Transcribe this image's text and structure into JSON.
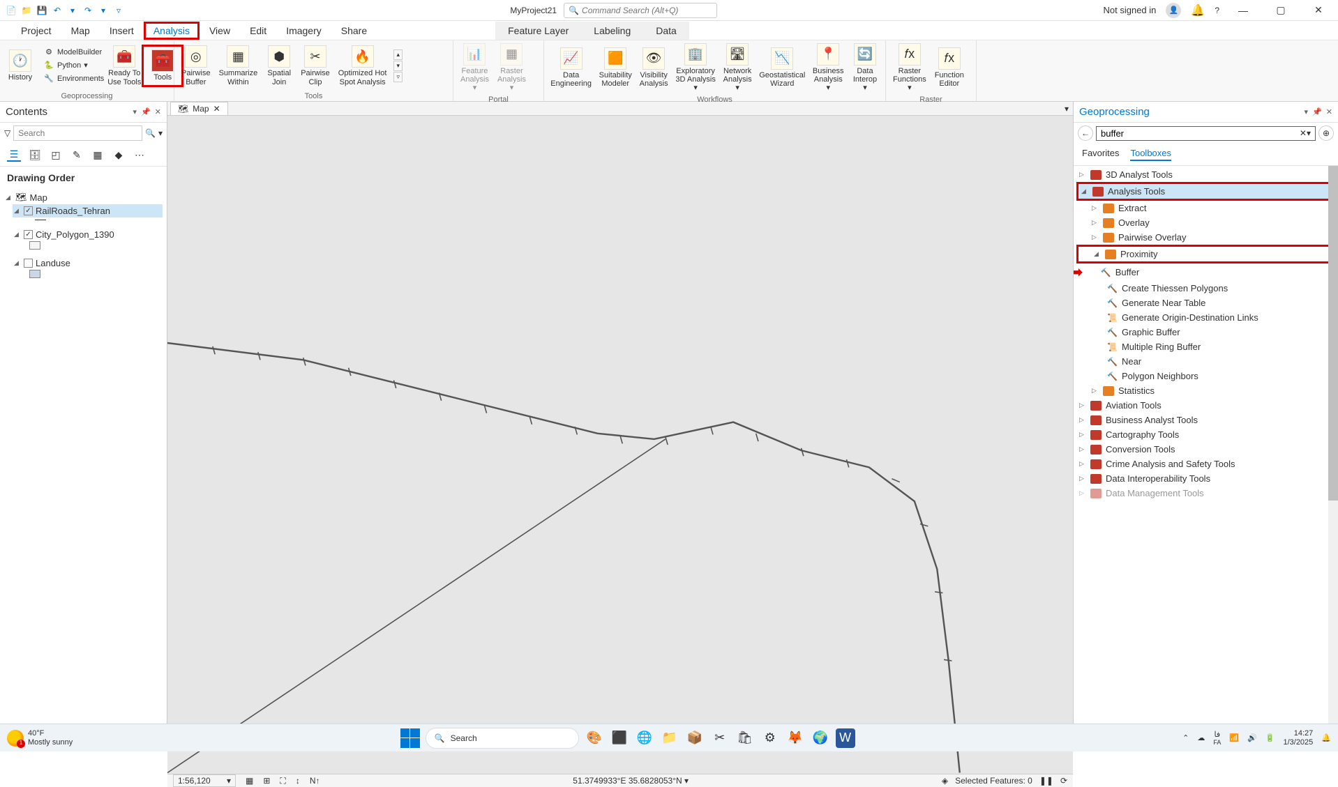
{
  "titlebar": {
    "project_name": "MyProject21",
    "cmd_search_placeholder": "Command Search (Alt+Q)",
    "signin": "Not signed in",
    "help": "?"
  },
  "ribbon_tabs": {
    "project": "Project",
    "map": "Map",
    "insert": "Insert",
    "analysis": "Analysis",
    "view": "View",
    "edit": "Edit",
    "imagery": "Imagery",
    "share": "Share",
    "feature_layer": "Feature Layer",
    "labeling": "Labeling",
    "data": "Data"
  },
  "ribbon": {
    "history": "History",
    "modelbuilder": "ModelBuilder",
    "python": "Python",
    "environments": "Environments",
    "ready_to_use": "Ready To\nUse Tools",
    "tools": "Tools",
    "group_gp": "Geoprocessing",
    "pairwise_buffer": "Pairwise\nBuffer",
    "summarize_within": "Summarize\nWithin",
    "spatial_join": "Spatial\nJoin",
    "pairwise_clip": "Pairwise\nClip",
    "hotspot": "Optimized Hot\nSpot Analysis",
    "group_tools": "Tools",
    "feature_analysis": "Feature\nAnalysis",
    "raster_analysis": "Raster\nAnalysis",
    "group_portal": "Portal",
    "data_engineering": "Data\nEngineering",
    "suitability": "Suitability\nModeler",
    "visibility": "Visibility\nAnalysis",
    "exploratory": "Exploratory\n3D Analysis",
    "network": "Network\nAnalysis",
    "geostat": "Geostatistical\nWizard",
    "business": "Business\nAnalysis",
    "data_interop": "Data\nInterop",
    "group_workflows": "Workflows",
    "raster_functions": "Raster\nFunctions",
    "function_editor": "Function\nEditor",
    "group_raster": "Raster"
  },
  "contents": {
    "title": "Contents",
    "search_placeholder": "Search",
    "drawing_order": "Drawing Order",
    "map": "Map",
    "layer1": "RailRoads_Tehran",
    "layer2": "City_Polygon_1390",
    "layer3": "Landuse"
  },
  "mapview": {
    "tab": "Map",
    "scale": "1:56,120",
    "coords": "51.3749933°E 35.6828053°N",
    "selected": "Selected Features: 0"
  },
  "gp": {
    "title": "Geoprocessing",
    "search_value": "buffer",
    "tab_favorites": "Favorites",
    "tab_toolboxes": "Toolboxes",
    "tree": {
      "analyst3d": "3D Analyst Tools",
      "analysis": "Analysis Tools",
      "extract": "Extract",
      "overlay": "Overlay",
      "pairwise_overlay": "Pairwise Overlay",
      "proximity": "Proximity",
      "buffer": "Buffer",
      "thiessen": "Create Thiessen Polygons",
      "near_table": "Generate Near Table",
      "od_links": "Generate Origin-Destination Links",
      "graphic_buffer": "Graphic Buffer",
      "multi_ring": "Multiple Ring Buffer",
      "near": "Near",
      "poly_neighbors": "Polygon Neighbors",
      "statistics": "Statistics",
      "aviation": "Aviation Tools",
      "business_analyst": "Business Analyst Tools",
      "cartography": "Cartography Tools",
      "conversion": "Conversion Tools",
      "crime": "Crime Analysis and Safety Tools",
      "data_interop": "Data Interoperability Tools",
      "data_mgmt": "Data Management Tools"
    }
  },
  "taskbar": {
    "temp": "40°F",
    "weather": "Mostly sunny",
    "weather_badge": "1",
    "search": "Search",
    "lang": "FA",
    "lang2": "فا",
    "time": "14:27",
    "date": "1/3/2025"
  }
}
